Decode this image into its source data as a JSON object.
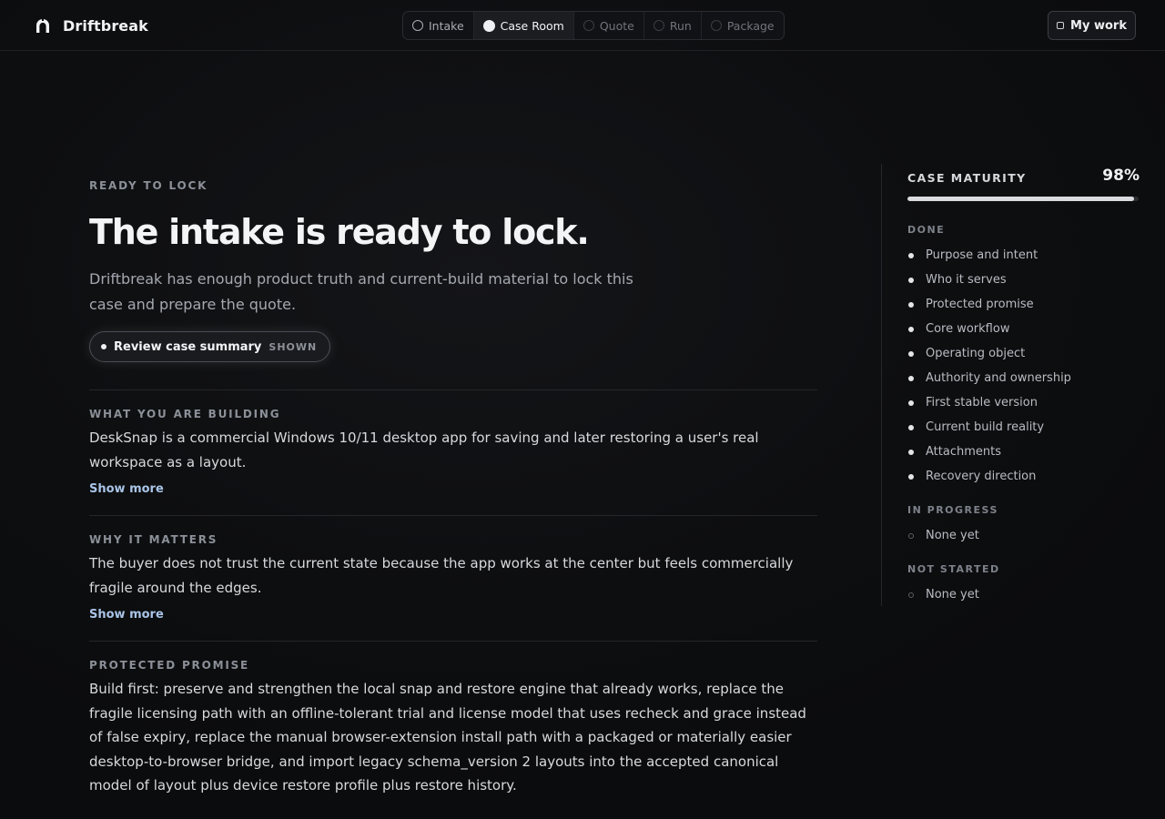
{
  "app": {
    "name": "Driftbreak"
  },
  "steps": [
    {
      "label": "Intake",
      "state": "done"
    },
    {
      "label": "Case Room",
      "state": "active"
    },
    {
      "label": "Quote",
      "state": "upcoming"
    },
    {
      "label": "Run",
      "state": "upcoming"
    },
    {
      "label": "Package",
      "state": "upcoming"
    }
  ],
  "header": {
    "my_work_label": "My work"
  },
  "main": {
    "eyebrow": "READY TO LOCK",
    "headline": "The intake is ready to lock.",
    "lede": "Driftbreak has enough product truth and current-build material to lock this case and prepare the quote.",
    "review_pill": {
      "label": "Review case summary",
      "state": "SHOWN"
    },
    "sections": [
      {
        "title": "WHAT YOU ARE BUILDING",
        "body": "DeskSnap is a commercial Windows 10/11 desktop app for saving and later restoring a user's real workspace as a layout.",
        "show_more": "Show more"
      },
      {
        "title": "WHY IT MATTERS",
        "body": "The buyer does not trust the current state because the app works at the center but feels commercially fragile around the edges.",
        "show_more": "Show more"
      },
      {
        "title": "PROTECTED PROMISE",
        "body": "Build first: preserve and strengthen the local snap and restore engine that already works, replace the fragile licensing path with an offline-tolerant trial and license model that uses recheck and grace instead of false expiry, replace the manual browser-extension install path with a packaged or materially easier desktop-to-browser bridge, and import legacy schema_version 2 layouts into the accepted canonical model of layout plus device restore profile plus restore history."
      }
    ]
  },
  "sidebar": {
    "title": "CASE MATURITY",
    "percent_label": "98%",
    "percent": 98,
    "groups": [
      {
        "title": "DONE",
        "items": [
          "Purpose and intent",
          "Who it serves",
          "Protected promise",
          "Core workflow",
          "Operating object",
          "Authority and ownership",
          "First stable version",
          "Current build reality",
          "Attachments",
          "Recovery direction"
        ]
      },
      {
        "title": "IN PROGRESS",
        "items": [
          "None yet"
        ]
      },
      {
        "title": "NOT STARTED",
        "items": [
          "None yet"
        ]
      }
    ]
  }
}
